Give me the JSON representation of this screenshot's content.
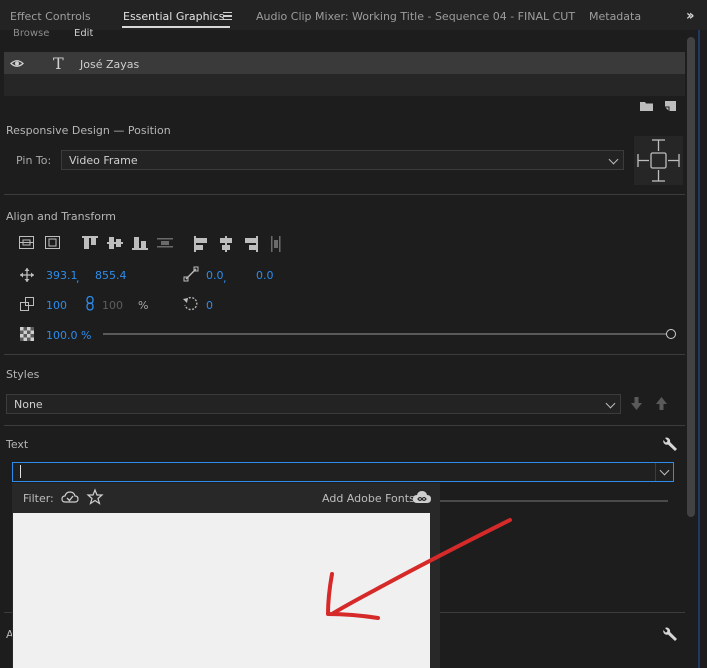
{
  "tabs": [
    {
      "label": "Effect Controls",
      "active": false
    },
    {
      "label": "Essential Graphics",
      "active": true
    },
    {
      "label": "Audio Clip Mixer: Working Title - Sequence 04 - FINAL CUT",
      "active": false
    },
    {
      "label": "Metadata",
      "active": false
    }
  ],
  "subtabs": {
    "browse": "Browse",
    "edit": "Edit"
  },
  "layer": {
    "name": "José Zayas"
  },
  "responsive": {
    "title": "Responsive Design — Position",
    "pin_label": "Pin To:",
    "pin_value": "Video Frame"
  },
  "align": {
    "title": "Align and Transform",
    "pos_x": "393.1",
    "pos_y": "855.4",
    "sep": ",",
    "anchor_x": "0.0",
    "anchor_y": "0.0",
    "scale_w": "100",
    "scale_h": "100",
    "scale_unit": "%",
    "rotation": "0",
    "opacity": "100.0 %",
    "opacity_fraction": 1.0
  },
  "styles": {
    "title": "Styles",
    "value": "None"
  },
  "text": {
    "title": "Text",
    "filter_label": "Filter:",
    "add_fonts_label": "Add Adobe Fonts:"
  },
  "colors": {
    "accent": "#2d8ceb",
    "annotation": "#d62a2a"
  }
}
